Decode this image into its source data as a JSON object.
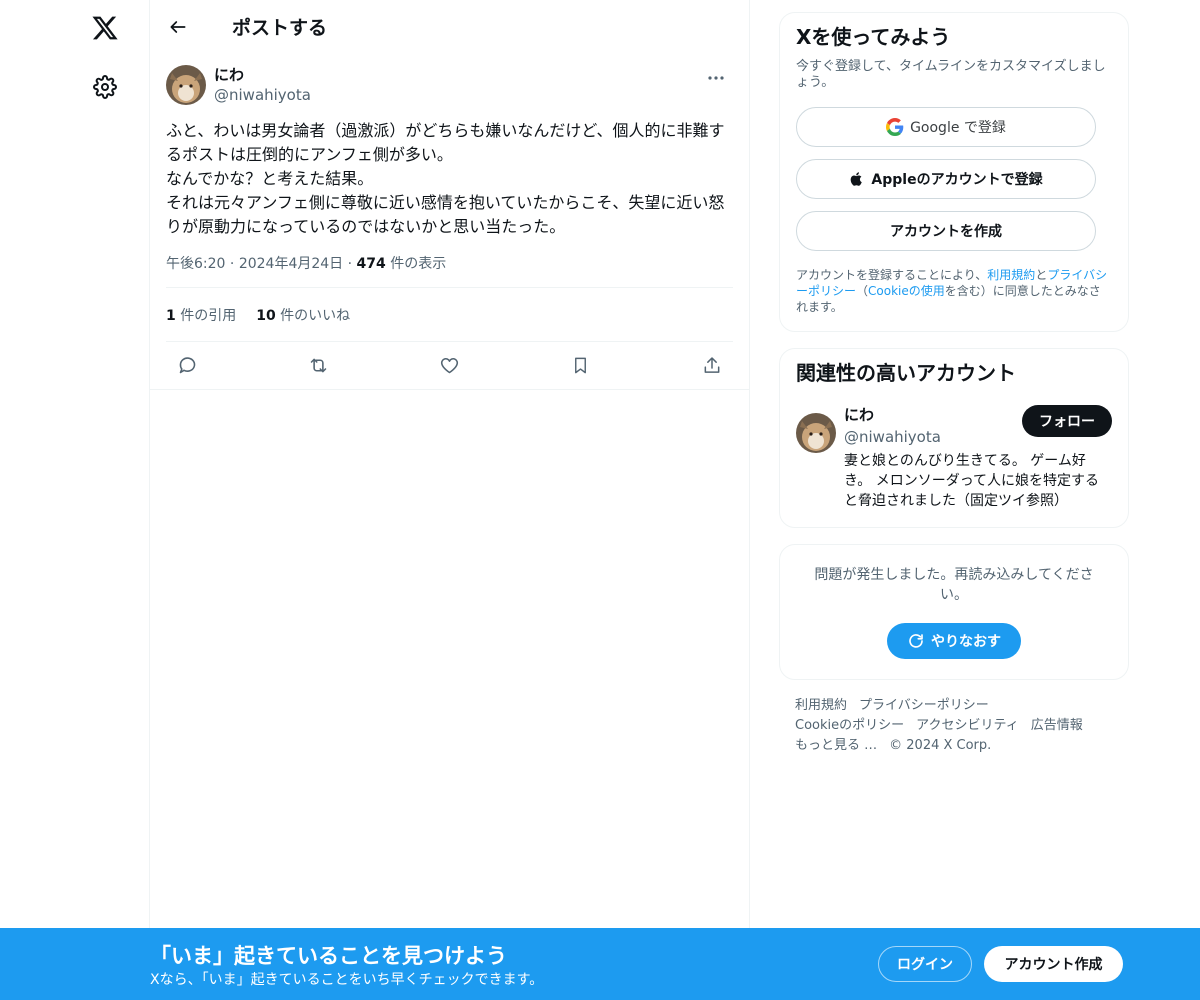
{
  "nav": {
    "logo_icon": "x-logo-icon",
    "settings_icon": "gear-icon"
  },
  "header": {
    "title": "ポストする",
    "back_icon": "arrow-left-icon"
  },
  "post": {
    "author_name": "にわ",
    "author_handle": "@niwahiyota",
    "more_icon": "more-horizontal-icon",
    "text_lines": [
      "ふと、わいは男女論者（過激派）がどちらも嫌いなんだけど、個人的に非難するポストは圧倒的にアンフェ側が多い。",
      "なんでかな？と考えた結果。",
      "それは元々アンフェ側に尊敬に近い感情を抱いていたからこそ、失望に近い怒りが原動力になっているのではないかと思い当たった。"
    ],
    "time": "午後6:20",
    "date": "2024年4月24日",
    "views_count": "474",
    "views_label": " 件の表示",
    "quotes_count": "1",
    "quotes_label": " 件の引用",
    "likes_count": "10",
    "likes_label": " 件のいいね",
    "action_icons": [
      "reply-icon",
      "repost-icon",
      "like-icon",
      "bookmark-icon",
      "share-icon"
    ]
  },
  "signup_card": {
    "title": "Xを使ってみよう",
    "subtitle": "今すぐ登録して、タイムラインをカスタマイズしましょう。",
    "google_label": "Google で登録",
    "apple_label": "Appleのアカウントで登録",
    "create_label": "アカウントを作成",
    "legal_prefix": "アカウントを登録することにより、",
    "legal_terms": "利用規約",
    "legal_and": "と",
    "legal_privacy": "プライバシーポリシー",
    "legal_open": "（",
    "legal_cookie": "Cookieの使用",
    "legal_suffix": "を含む）に同意したとみなされます。"
  },
  "related": {
    "title": "関連性の高いアカウント",
    "name": "にわ",
    "handle": "@niwahiyota",
    "follow_label": "フォロー",
    "bio": "妻と娘とのんびり生きてる。 ゲーム好き。 メロンソーダって人に娘を特定すると脅迫されました（固定ツイ参照）"
  },
  "error_card": {
    "message": "問題が発生しました。再読み込みしてください。",
    "retry_label": "やりなおす"
  },
  "footer": {
    "terms": "利用規約",
    "privacy": "プライバシーポリシー",
    "cookie": "Cookieのポリシー",
    "accessibility": "アクセシビリティ",
    "ads": "広告情報",
    "more": "もっと見る …",
    "copyright": "© 2024 X Corp."
  },
  "banner": {
    "title": "「いま」起きていることを見つけよう",
    "subtitle": "Xなら、「いま」起きていることをいち早くチェックできます。",
    "login_label": "ログイン",
    "signup_label": "アカウント作成"
  },
  "colors": {
    "accent": "#1d9bf0",
    "text": "#0f1419",
    "muted": "#536471",
    "border": "#eff3f4"
  }
}
